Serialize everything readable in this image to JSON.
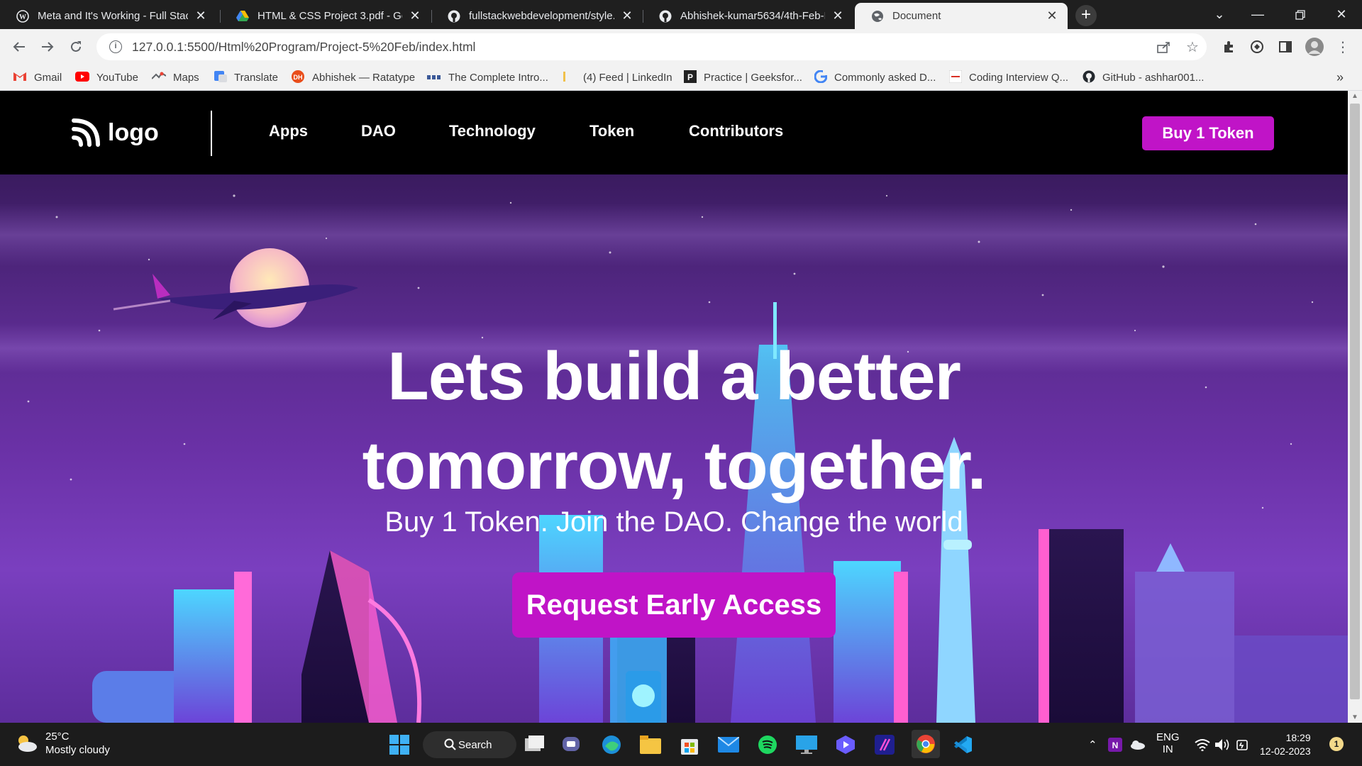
{
  "browser": {
    "tabs": [
      {
        "title": "Meta and It's Working - Full Stac",
        "active": false
      },
      {
        "title": "HTML & CSS Project 3.pdf - Goog",
        "active": false
      },
      {
        "title": "fullstackwebdevelopment/style.cs",
        "active": false
      },
      {
        "title": "Abhishek-kumar5634/4th-Feb-Pr",
        "active": false
      },
      {
        "title": "Document",
        "active": true
      }
    ],
    "url": "127.0.0.1:5500/Html%20Program/Project-5%20Feb/index.html",
    "bookmarks": [
      {
        "label": "Gmail",
        "color": "#ea4335"
      },
      {
        "label": "YouTube",
        "color": "#ff0000"
      },
      {
        "label": "Maps",
        "color": "#34a853"
      },
      {
        "label": "Translate",
        "color": "#4285f4"
      },
      {
        "label": "Abhishek — Ratatype",
        "color": "#e94e1b"
      },
      {
        "label": "The Complete Intro...",
        "color": "#3b5998"
      },
      {
        "label": "(4) Feed | LinkedIn",
        "color": "#f0c14b"
      },
      {
        "label": "Practice | Geeksfor...",
        "color": "#222222"
      },
      {
        "label": "Commonly asked D...",
        "color": "#4285f4"
      },
      {
        "label": "Coding Interview Q...",
        "color": "#d93025"
      },
      {
        "label": "GitHub - ashhar001...",
        "color": "#24292e"
      }
    ],
    "more_bookmarks": "»"
  },
  "site": {
    "logo_text": "logo",
    "nav": [
      "Apps",
      "DAO",
      "Technology",
      "Token",
      "Contributors"
    ],
    "buy_button": "Buy 1 Token",
    "hero": {
      "title_line1": "Lets build a better",
      "title_line2": "tomorrow, together.",
      "subtitle": "Buy 1 Token. Join the DAO. Change the world",
      "cta": "Request Early Access"
    },
    "colors": {
      "accent": "#c014c7",
      "nav_bg": "#000000"
    }
  },
  "taskbar": {
    "weather_temp": "25°C",
    "weather_desc": "Mostly cloudy",
    "search_label": "Search",
    "lang_line1": "ENG",
    "lang_line2": "IN",
    "time": "18:29",
    "date": "12-02-2023",
    "notification_count": "1"
  }
}
